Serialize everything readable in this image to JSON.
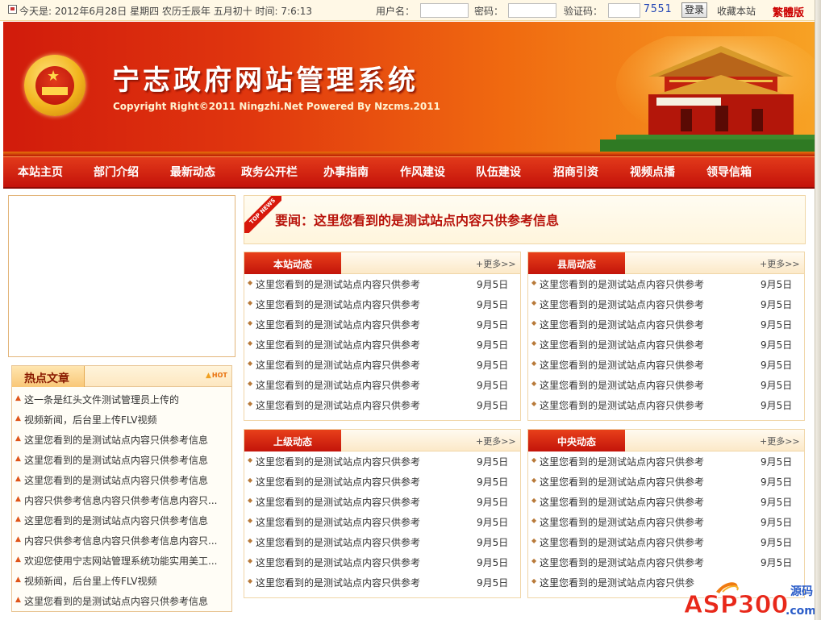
{
  "topbar": {
    "date_text": "今天是: 2012年6月28日  星期四  农历壬辰年  五月初十  时间: 7:6:13",
    "username_label": "用户名：",
    "password_label": "密码：",
    "captcha_label": "验证码：",
    "captcha_value": "7551",
    "login_label": "登录",
    "favorite_label": "收藏本站",
    "traditional_label": "繁體版"
  },
  "banner": {
    "title": "宁志政府网站管理系统",
    "copyright": "Copyright Right©2011 Ningzhi.Net Powered By Nzcms.2011"
  },
  "nav": {
    "items": [
      {
        "label": "本站主页"
      },
      {
        "label": "部门介绍"
      },
      {
        "label": "最新动态"
      },
      {
        "label": "政务公开栏"
      },
      {
        "label": "办事指南"
      },
      {
        "label": "作风建设"
      },
      {
        "label": "队伍建设"
      },
      {
        "label": "招商引资"
      },
      {
        "label": "视频点播"
      },
      {
        "label": "领导信箱"
      }
    ]
  },
  "hot": {
    "title": "热点文章",
    "badge": "HOT",
    "items": [
      "这一条是红头文件测试管理员上传的",
      "视频新闻，后台里上传FLV视频",
      "这里您看到的是测试站点内容只供参考信息",
      "这里您看到的是测试站点内容只供参考信息",
      "这里您看到的是测试站点内容只供参考信息",
      "内容只供参考信息内容只供参考信息内容只...",
      "这里您看到的是测试站点内容只供参考信息",
      "内容只供参考信息内容只供参考信息内容只...",
      "欢迎您使用宁志网站管理系统功能实用美工...",
      "视频新闻，后台里上传FLV视频",
      "这里您看到的是测试站点内容只供参考信息"
    ]
  },
  "headline": {
    "ribbon": "TOP NEWS",
    "text": "要闻：这里您看到的是测试站点内容只供参考信息"
  },
  "sections": [
    {
      "title": "本站动态",
      "more": "+更多>>",
      "items": [
        {
          "title": "这里您看到的是测试站点内容只供参考",
          "date": "9月5日"
        },
        {
          "title": "这里您看到的是测试站点内容只供参考",
          "date": "9月5日"
        },
        {
          "title": "这里您看到的是测试站点内容只供参考",
          "date": "9月5日"
        },
        {
          "title": "这里您看到的是测试站点内容只供参考",
          "date": "9月5日"
        },
        {
          "title": "这里您看到的是测试站点内容只供参考",
          "date": "9月5日"
        },
        {
          "title": "这里您看到的是测试站点内容只供参考",
          "date": "9月5日"
        },
        {
          "title": "这里您看到的是测试站点内容只供参考",
          "date": "9月5日"
        }
      ]
    },
    {
      "title": "县局动态",
      "more": "+更多>>",
      "items": [
        {
          "title": "这里您看到的是测试站点内容只供参考",
          "date": "9月5日"
        },
        {
          "title": "这里您看到的是测试站点内容只供参考",
          "date": "9月5日"
        },
        {
          "title": "这里您看到的是测试站点内容只供参考",
          "date": "9月5日"
        },
        {
          "title": "这里您看到的是测试站点内容只供参考",
          "date": "9月5日"
        },
        {
          "title": "这里您看到的是测试站点内容只供参考",
          "date": "9月5日"
        },
        {
          "title": "这里您看到的是测试站点内容只供参考",
          "date": "9月5日"
        },
        {
          "title": "这里您看到的是测试站点内容只供参考",
          "date": "9月5日"
        }
      ]
    },
    {
      "title": "上级动态",
      "more": "+更多>>",
      "items": [
        {
          "title": "这里您看到的是测试站点内容只供参考",
          "date": "9月5日"
        },
        {
          "title": "这里您看到的是测试站点内容只供参考",
          "date": "9月5日"
        },
        {
          "title": "这里您看到的是测试站点内容只供参考",
          "date": "9月5日"
        },
        {
          "title": "这里您看到的是测试站点内容只供参考",
          "date": "9月5日"
        },
        {
          "title": "这里您看到的是测试站点内容只供参考",
          "date": "9月5日"
        },
        {
          "title": "这里您看到的是测试站点内容只供参考",
          "date": "9月5日"
        },
        {
          "title": "这里您看到的是测试站点内容只供参考",
          "date": "9月5日"
        }
      ]
    },
    {
      "title": "中央动态",
      "more": "+更多>>",
      "items": [
        {
          "title": "这里您看到的是测试站点内容只供参考",
          "date": "9月5日"
        },
        {
          "title": "这里您看到的是测试站点内容只供参考",
          "date": "9月5日"
        },
        {
          "title": "这里您看到的是测试站点内容只供参考",
          "date": "9月5日"
        },
        {
          "title": "这里您看到的是测试站点内容只供参考",
          "date": "9月5日"
        },
        {
          "title": "这里您看到的是测试站点内容只供参考",
          "date": "9月5日"
        },
        {
          "title": "这里您看到的是测试站点内容只供参考",
          "date": "9月5日"
        },
        {
          "title": "这里您看到的是测试站点内容只供参",
          "date": ""
        }
      ]
    }
  ],
  "watermark": {
    "brand": "ASP300",
    "tag": "源码",
    "domain": ".com"
  },
  "colors": {
    "nav_red": "#c4120a",
    "headline_red": "#b8120a",
    "banner_orange": "#f06a10"
  }
}
